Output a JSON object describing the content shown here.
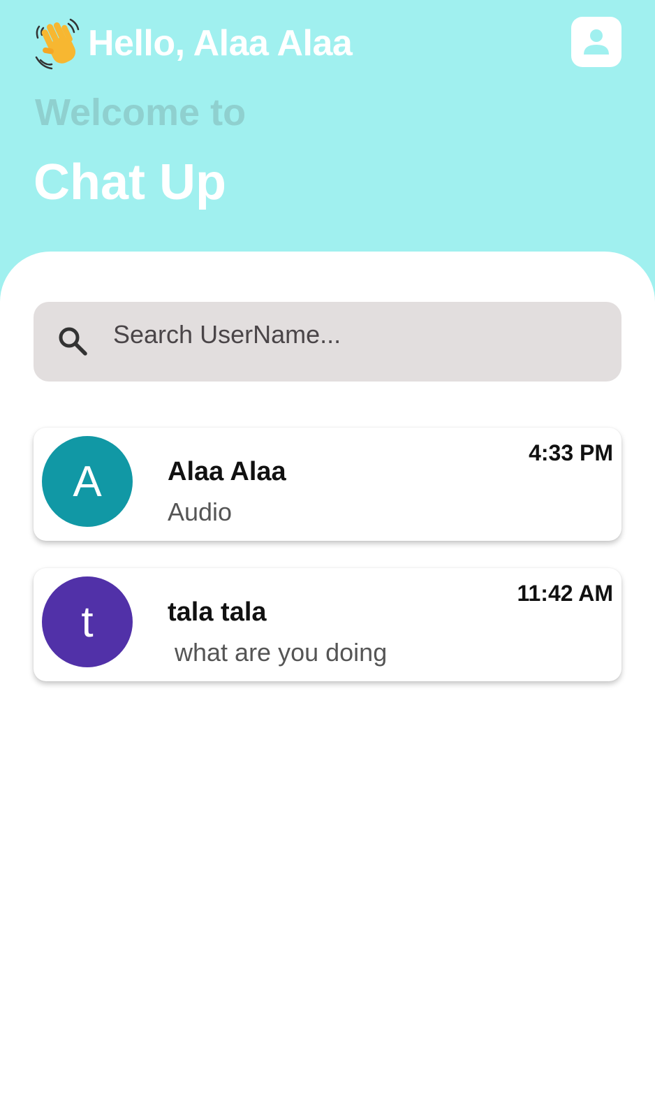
{
  "header": {
    "greeting": "Hello, Alaa Alaa",
    "greeting_icon": "waving-hand-icon",
    "welcome": "Welcome to",
    "app_title": "Chat Up",
    "profile_icon": "user-profile-icon"
  },
  "search": {
    "placeholder": "Search UserName...",
    "icon": "search-icon"
  },
  "chats": [
    {
      "avatar_letter": "A",
      "avatar_color": "#1198a5",
      "name": "Alaa Alaa",
      "preview": "Audio",
      "time": "4:33 PM"
    },
    {
      "avatar_letter": "t",
      "avatar_color": "#5131a8",
      "name": "tala tala",
      "preview": " what are you doing",
      "time": "11:42 AM"
    }
  ],
  "colors": {
    "header_background": "#a0f0ef",
    "welcome_text": "#8fd0cf",
    "search_background": "#e2dede"
  }
}
